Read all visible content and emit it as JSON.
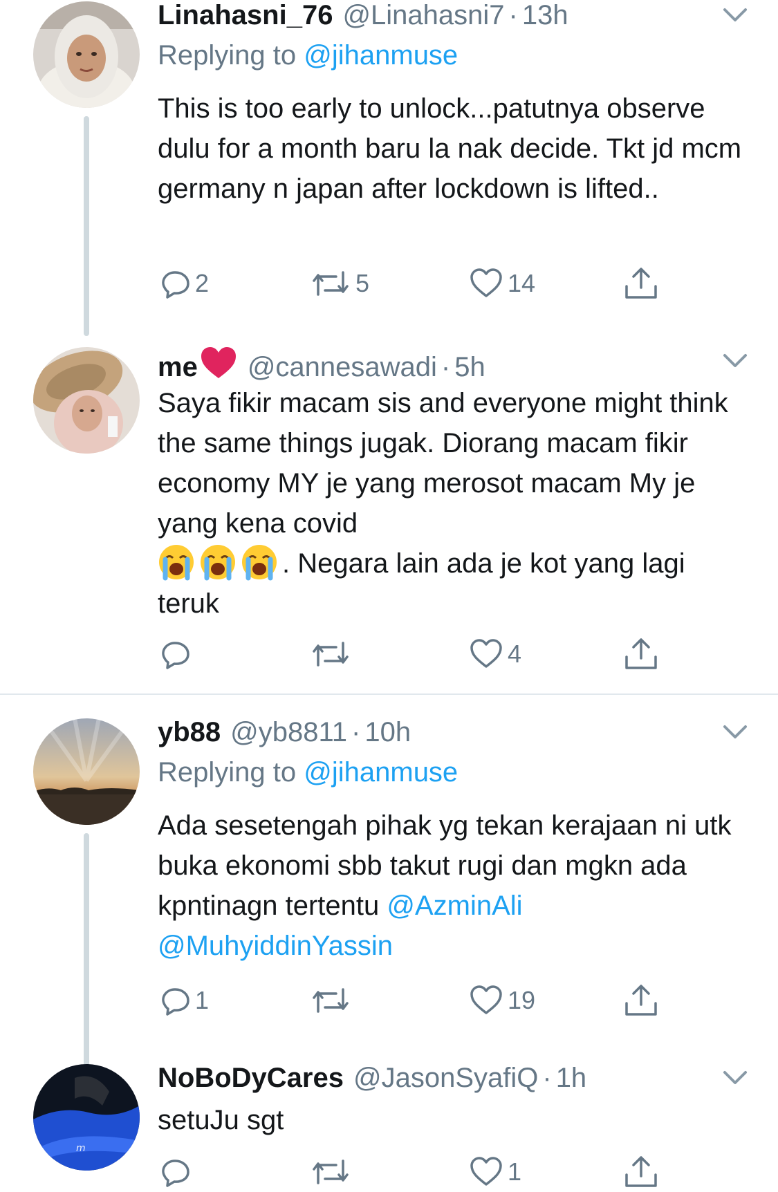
{
  "tweets": [
    {
      "name": "Linahasni_76",
      "handle": "@Linahasni7",
      "time": "13h",
      "replying_prefix": "Replying to",
      "replying_to": "@jihanmuse",
      "text": "This is too early to unlock...patutnya observe dulu for a month baru la nak decide. Tkt jd mcm germany n japan after lockdown is lifted..",
      "replies": "2",
      "retweets": "5",
      "likes": "14"
    },
    {
      "name": "me",
      "handle": "@cannesawadi",
      "time": "5h",
      "text_line1": "Saya fikir macam sis and everyone might think the same things jugak. Diorang macam fikir economy MY je yang merosot macam My je yang kena covid",
      "text_line2": ". Negara lain ada je kot yang lagi teruk",
      "replies": "",
      "retweets": "",
      "likes": "4",
      "emoji_name": "loudly-crying-face"
    },
    {
      "name": "yb88",
      "handle": "@yb8811",
      "time": "10h",
      "replying_prefix": "Replying to",
      "replying_to": "@jihanmuse",
      "text": "Ada sesetengah pihak yg tekan kerajaan ni utk buka ekonomi sbb takut rugi dan mgkn ada kpntinagn tertentu",
      "mention1": "@AzminAli",
      "mention2": "@MuhyiddinYassin",
      "replies": "1",
      "retweets": "",
      "likes": "19"
    },
    {
      "name": "NoBoDyCares",
      "handle": "@JasonSyafiQ",
      "time": "1h",
      "text": "setuJu sgt",
      "replies": "",
      "retweets": "",
      "likes": "1"
    }
  ],
  "colors": {
    "accent": "#1da1f2",
    "secondary_text": "#657786",
    "heart_red": "#e0245e"
  },
  "icons": [
    "reply-icon",
    "retweet-icon",
    "like-icon",
    "share-icon",
    "chevron-down-icon",
    "heart-emoji-icon"
  ]
}
